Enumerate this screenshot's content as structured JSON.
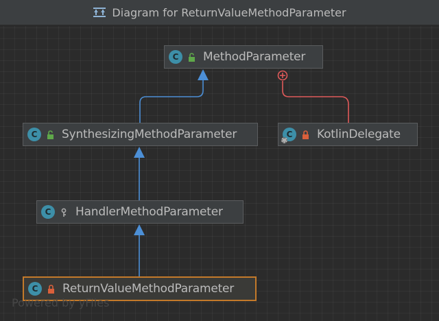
{
  "window": {
    "title": "Diagram for ReturnValueMethodParameter",
    "icon": "diagram-icon"
  },
  "nodes": {
    "method_parameter": {
      "label": "MethodParameter",
      "kind": "class",
      "visibility": "public"
    },
    "synthesizing": {
      "label": "SynthesizingMethodParameter",
      "kind": "class",
      "visibility": "public"
    },
    "kotlin_delegate": {
      "label": "KotlinDelegate",
      "kind": "class",
      "visibility": "private"
    },
    "handler": {
      "label": "HandlerMethodParameter",
      "kind": "class",
      "visibility": "protected"
    },
    "return_value": {
      "label": "ReturnValueMethodParameter",
      "kind": "class",
      "visibility": "private",
      "selected": true
    }
  },
  "edges": [
    {
      "from": "synthesizing",
      "to": "method_parameter",
      "type": "extends"
    },
    {
      "from": "handler",
      "to": "synthesizing",
      "type": "extends"
    },
    {
      "from": "return_value",
      "to": "handler",
      "type": "extends"
    },
    {
      "from": "kotlin_delegate",
      "to": "method_parameter",
      "type": "inner-class"
    }
  ],
  "colors": {
    "extends_edge": "#4c8fd6",
    "inner_edge": "#e05a5a",
    "selected_border": "#c47a2a",
    "class_icon": "#3d8fa8",
    "public_lock": "#5fa84a",
    "private_lock": "#d9603b"
  },
  "watermark": "Powered by yFiles"
}
